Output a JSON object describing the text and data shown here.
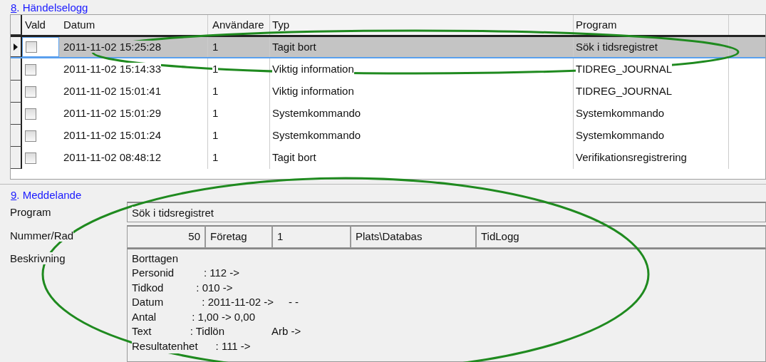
{
  "event_log": {
    "title_key": "8",
    "title_rest": ". Händelselogg",
    "columns": [
      "Vald",
      "Datum",
      "Användare",
      "Typ",
      "Program"
    ],
    "rows": [
      {
        "current": true,
        "selected": true,
        "checked": false,
        "date": "2011-11-02 15:25:28",
        "user": "1",
        "type": "Tagit bort",
        "program": "Sök i tidsregistret"
      },
      {
        "current": false,
        "selected": false,
        "checked": false,
        "date": "2011-11-02 15:14:33",
        "user": "1",
        "type": "Viktig information",
        "program": "TIDREG_JOURNAL"
      },
      {
        "current": false,
        "selected": false,
        "checked": false,
        "date": "2011-11-02 15:01:41",
        "user": "1",
        "type": "Viktig information",
        "program": "TIDREG_JOURNAL"
      },
      {
        "current": false,
        "selected": false,
        "checked": false,
        "date": "2011-11-02 15:01:29",
        "user": "1",
        "type": "Systemkommando",
        "program": "Systemkommando"
      },
      {
        "current": false,
        "selected": false,
        "checked": false,
        "date": "2011-11-02 15:01:24",
        "user": "1",
        "type": "Systemkommando",
        "program": "Systemkommando"
      },
      {
        "current": false,
        "selected": false,
        "checked": false,
        "date": "2011-11-02 08:48:12",
        "user": "1",
        "type": "Tagit bort",
        "program": "Verifikationsregistrering"
      }
    ]
  },
  "message": {
    "title_key": "9",
    "title_rest": ". Meddelande",
    "program_label": "Program",
    "program_value": "Sök i tidsregistret",
    "number_label": "Nummer/Rad",
    "number_value": "50",
    "company_label": "Företag",
    "company_value": "1",
    "location_label": "Plats\\Databas",
    "location_value": "TidLogg",
    "description_label": "Beskrivning",
    "description_lines": [
      "Borttagen",
      "Personid          : 112 ->",
      "Tidkod           : 010 ->",
      "Datum             : 2011-11-02 ->     - -",
      "Antal            : 1,00 -> 0,00",
      "Text             : Tidlön                Arb ->",
      "Resultatenhet      : 111 ->"
    ]
  }
}
